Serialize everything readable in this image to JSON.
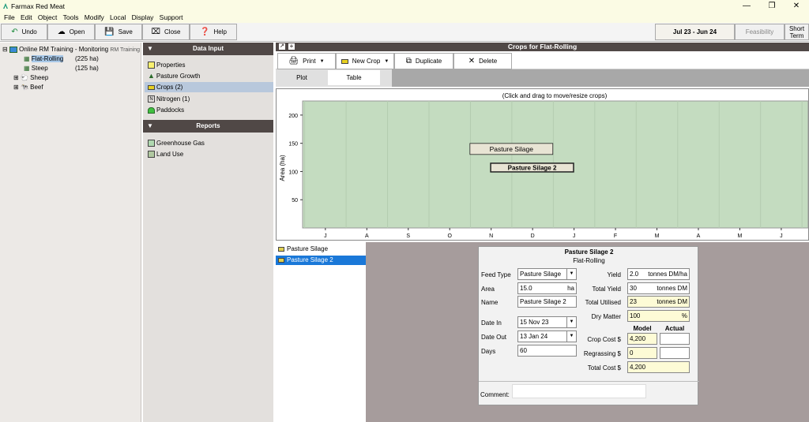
{
  "app": {
    "title": "Farmax Red Meat"
  },
  "menu": [
    "File",
    "Edit",
    "Object",
    "Tools",
    "Modify",
    "Local",
    "Display",
    "Support"
  ],
  "toolbar": {
    "undo": "Undo",
    "open": "Open",
    "save": "Save",
    "close": "Close",
    "help": "Help",
    "period": "Jul 23 - Jun 24",
    "feasibility": "Feasibility",
    "short_term_1": "Short",
    "short_term_2": "Term"
  },
  "tree": {
    "root": "Online RM Training - Monitoring",
    "root_suffix": "RM Training",
    "items": [
      {
        "label": "Flat-Rolling",
        "size": "(225 ha)"
      },
      {
        "label": "Steep",
        "size": "(125 ha)"
      },
      {
        "label": "Sheep",
        "size": ""
      },
      {
        "label": "Beef",
        "size": ""
      }
    ]
  },
  "data_input": {
    "header": "Data Input",
    "items": [
      "Properties",
      "Pasture Growth",
      "Crops (2)",
      "Nitrogen (1)",
      "Paddocks"
    ]
  },
  "reports": {
    "header": "Reports",
    "items": [
      "Greenhouse Gas",
      "Land Use"
    ]
  },
  "crops_panel": {
    "title": "Crops for Flat-Rolling",
    "print": "Print",
    "new_crop": "New Crop",
    "duplicate": "Duplicate",
    "delete": "Delete",
    "tab_plot": "Plot",
    "tab_table": "Table",
    "hint": "(Click and drag to move/resize crops)"
  },
  "chart_data": {
    "type": "gantt",
    "ylabel": "Area (ha)",
    "ylim": [
      0,
      225
    ],
    "yticks": [
      50,
      100,
      150,
      200
    ],
    "x_tick_labels": [
      "J",
      "A",
      "S",
      "O",
      "N",
      "D",
      "J",
      "F",
      "M",
      "A",
      "M",
      "J"
    ],
    "crops": [
      {
        "name": "Pasture Silage",
        "start_month_index": 4,
        "end_month_index": 6,
        "area_center": 140,
        "bold": false
      },
      {
        "name": "Pasture Silage 2",
        "start_month_index": 4.5,
        "end_month_index": 6.5,
        "area_center": 107,
        "bold": true
      }
    ],
    "colors": {
      "plot_bg": "#c4dcc0"
    }
  },
  "crop_list": [
    "Pasture Silage",
    "Pasture Silage 2"
  ],
  "form": {
    "title": "Pasture Silage 2",
    "subtitle": "Flat-Rolling",
    "feed_type_label": "Feed Type",
    "feed_type": "Pasture Silage",
    "area_label": "Area",
    "area": "15.0",
    "area_unit": "ha",
    "name_label": "Name",
    "name": "Pasture Silage 2",
    "date_in_label": "Date In",
    "date_in": "15 Nov 23",
    "date_out_label": "Date Out",
    "date_out": "13 Jan 24",
    "days_label": "Days",
    "days": "60",
    "yield_label": "Yield",
    "yield": "2.0",
    "yield_unit": "tonnes DM/ha",
    "total_yield_label": "Total Yield",
    "total_yield": "30",
    "total_yield_unit": "tonnes DM",
    "total_utilised_label": "Total Utilised",
    "total_utilised": "23",
    "total_utilised_unit": "tonnes DM",
    "dry_matter_label": "Dry Matter",
    "dry_matter": "100",
    "dry_matter_unit": "%",
    "model_label": "Model",
    "actual_label": "Actual",
    "crop_cost_label": "Crop Cost $",
    "crop_cost": "4,200",
    "regrassing_label": "Regrassing $",
    "regrassing": "0",
    "total_cost_label": "Total Cost $",
    "total_cost": "4,200",
    "comment_label": "Comment:"
  }
}
